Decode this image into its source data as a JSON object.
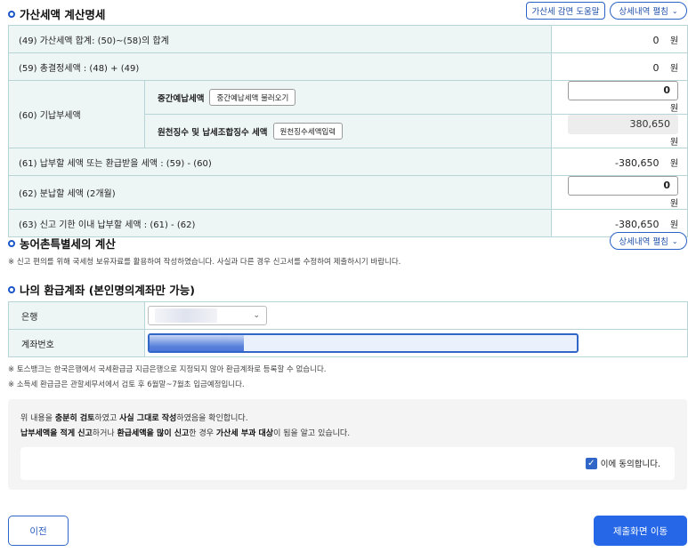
{
  "section1": {
    "title": "가산세액 계산명세",
    "help_button": "가산세 감면 도움말",
    "detail_button": "상세내역 펼침"
  },
  "unit": "원",
  "rows": {
    "r49": {
      "label": "(49) 가산세액 합계: (50)~(58)의 합계",
      "value": "0"
    },
    "r59": {
      "label": "(59) 총결정세액 : (48) + (49)",
      "value": "0"
    },
    "r60": {
      "label": "(60) 기납부세액",
      "interim_label": "중간예납세액",
      "interim_button": "중간예납세액 불러오기",
      "interim_value": "0",
      "withhold_label": "원천징수 및 납세조합징수 세액",
      "withhold_button": "원천징수세액입력",
      "withhold_value": "380,650"
    },
    "r61": {
      "label": "(61) 납부할 세액 또는 환급받을 세액 : (59) - (60)",
      "value": "-380,650"
    },
    "r62": {
      "label": "(62) 분납할 세액 (2개월)",
      "value": "0"
    },
    "r63": {
      "label": "(63) 신고 기한 이내 납부할 세액 : (61) - (62)",
      "value": "-380,650"
    }
  },
  "section2": {
    "title": "농어촌특별세의 계산",
    "detail_button": "상세내역 펼침",
    "note": "※ 신고 편의를 위해 국세청 보유자료를 활용하여 작성하였습니다. 사실과 다른 경우 신고서를 수정하여 제출하시기 바랍니다."
  },
  "section3": {
    "title": "나의 환급계좌 (본인명의계좌만 가능)",
    "bank_label": "은행",
    "account_label": "계좌번호",
    "note1": "※ 토스뱅크는 한국은행에서 국세환급금 지급은행으로 지정되지 않아 환급계좌로 등록할 수 없습니다.",
    "note2": "※ 소득세 환급금은 관할세무서에서 검토 후 6월말~7월초 입금예정입니다."
  },
  "confirm": {
    "l1_a": "위 내용을 ",
    "l1_b": "충분히 검토",
    "l1_c": "하였고 ",
    "l1_d": "사실 그대로 작성",
    "l1_e": "하였음을 확인합니다.",
    "l2_a": "납부세액을 적게 신고",
    "l2_b": "하거나 ",
    "l2_c": "환급세액을 많이 신고",
    "l2_d": "한 경우 ",
    "l2_e": "가산세 부과 대상",
    "l2_f": "이 됨을 알고 있습니다.",
    "agree_label": "이에 동의합니다.",
    "agreed": true
  },
  "nav": {
    "prev": "이전",
    "next": "제출화면 이동"
  },
  "colors": {
    "accent": "#2567e6",
    "table_label_bg": "#eef6f5",
    "table_border": "#b7d4d6"
  }
}
